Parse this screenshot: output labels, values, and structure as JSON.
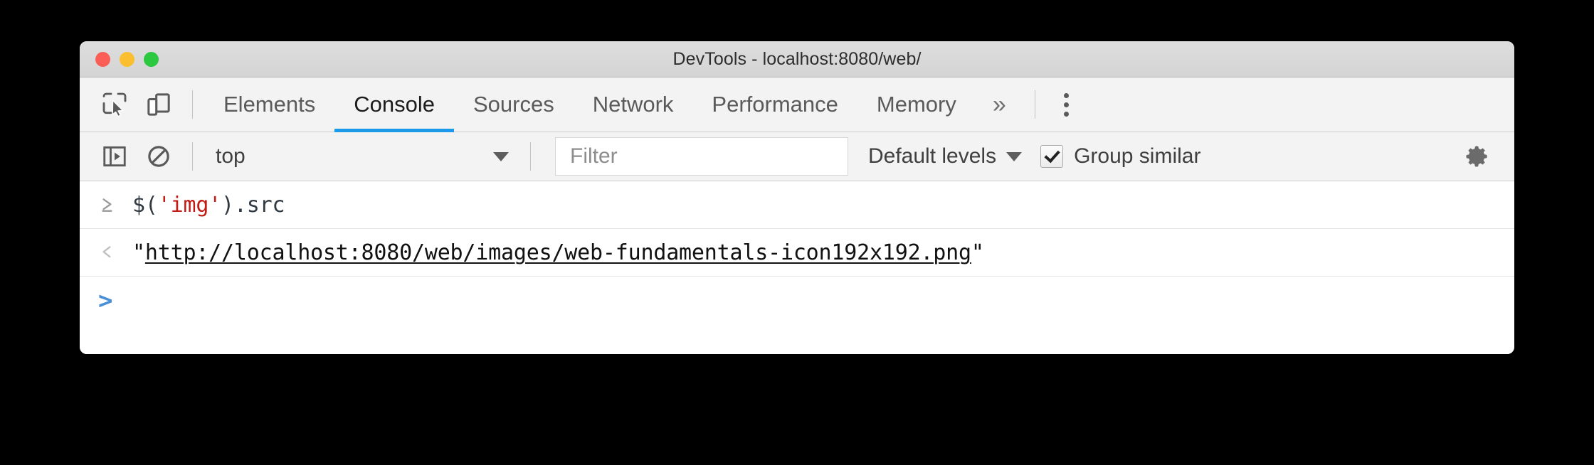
{
  "window": {
    "title": "DevTools - localhost:8080/web/",
    "traffic_lights": [
      {
        "name": "close",
        "color": "#fa5e57"
      },
      {
        "name": "minimize",
        "color": "#fbbe2e"
      },
      {
        "name": "zoom",
        "color": "#2bc840"
      }
    ]
  },
  "toolbar_icons": {
    "inspect": "inspect-element-icon",
    "device": "device-toolbar-icon",
    "kebab": "more-options-icon"
  },
  "tabs": {
    "items": [
      {
        "label": "Elements",
        "active": false
      },
      {
        "label": "Console",
        "active": true
      },
      {
        "label": "Sources",
        "active": false
      },
      {
        "label": "Network",
        "active": false
      },
      {
        "label": "Performance",
        "active": false
      },
      {
        "label": "Memory",
        "active": false
      }
    ],
    "overflow_label": "»",
    "active_underline_color": "#1a9ae8"
  },
  "console_toolbar": {
    "sidebar_toggle": "console-sidebar-toggle-icon",
    "clear_console": "clear-console-icon",
    "context": {
      "selected": "top",
      "options": [
        "top"
      ]
    },
    "filter": {
      "value": "",
      "placeholder": "Filter"
    },
    "levels": {
      "label": "Default levels"
    },
    "group_similar": {
      "label": "Group similar",
      "checked": true
    },
    "settings": "settings-gear-icon"
  },
  "console": {
    "rows": [
      {
        "kind": "input",
        "marker": "input-arrow-icon",
        "tokens": [
          {
            "text": "$(",
            "type": "plain"
          },
          {
            "text": "'img'",
            "type": "string"
          },
          {
            "text": ").src",
            "type": "plain"
          }
        ],
        "full_text": "$('img').src"
      },
      {
        "kind": "result",
        "marker": "result-arrow-icon",
        "quote": "\"",
        "link": "http://localhost:8080/web/images/web-fundamentals-icon192x192.png",
        "full_text": "\"http://localhost:8080/web/images/web-fundamentals-icon192x192.png\""
      },
      {
        "kind": "prompt",
        "marker": ">",
        "value": ""
      }
    ]
  },
  "colors": {
    "accent": "#1a9ae8",
    "string_literal": "#c41a16",
    "prompt": "#4a90d9",
    "titlebar": "#d9d9d9",
    "toolbar": "#f3f3f3"
  }
}
